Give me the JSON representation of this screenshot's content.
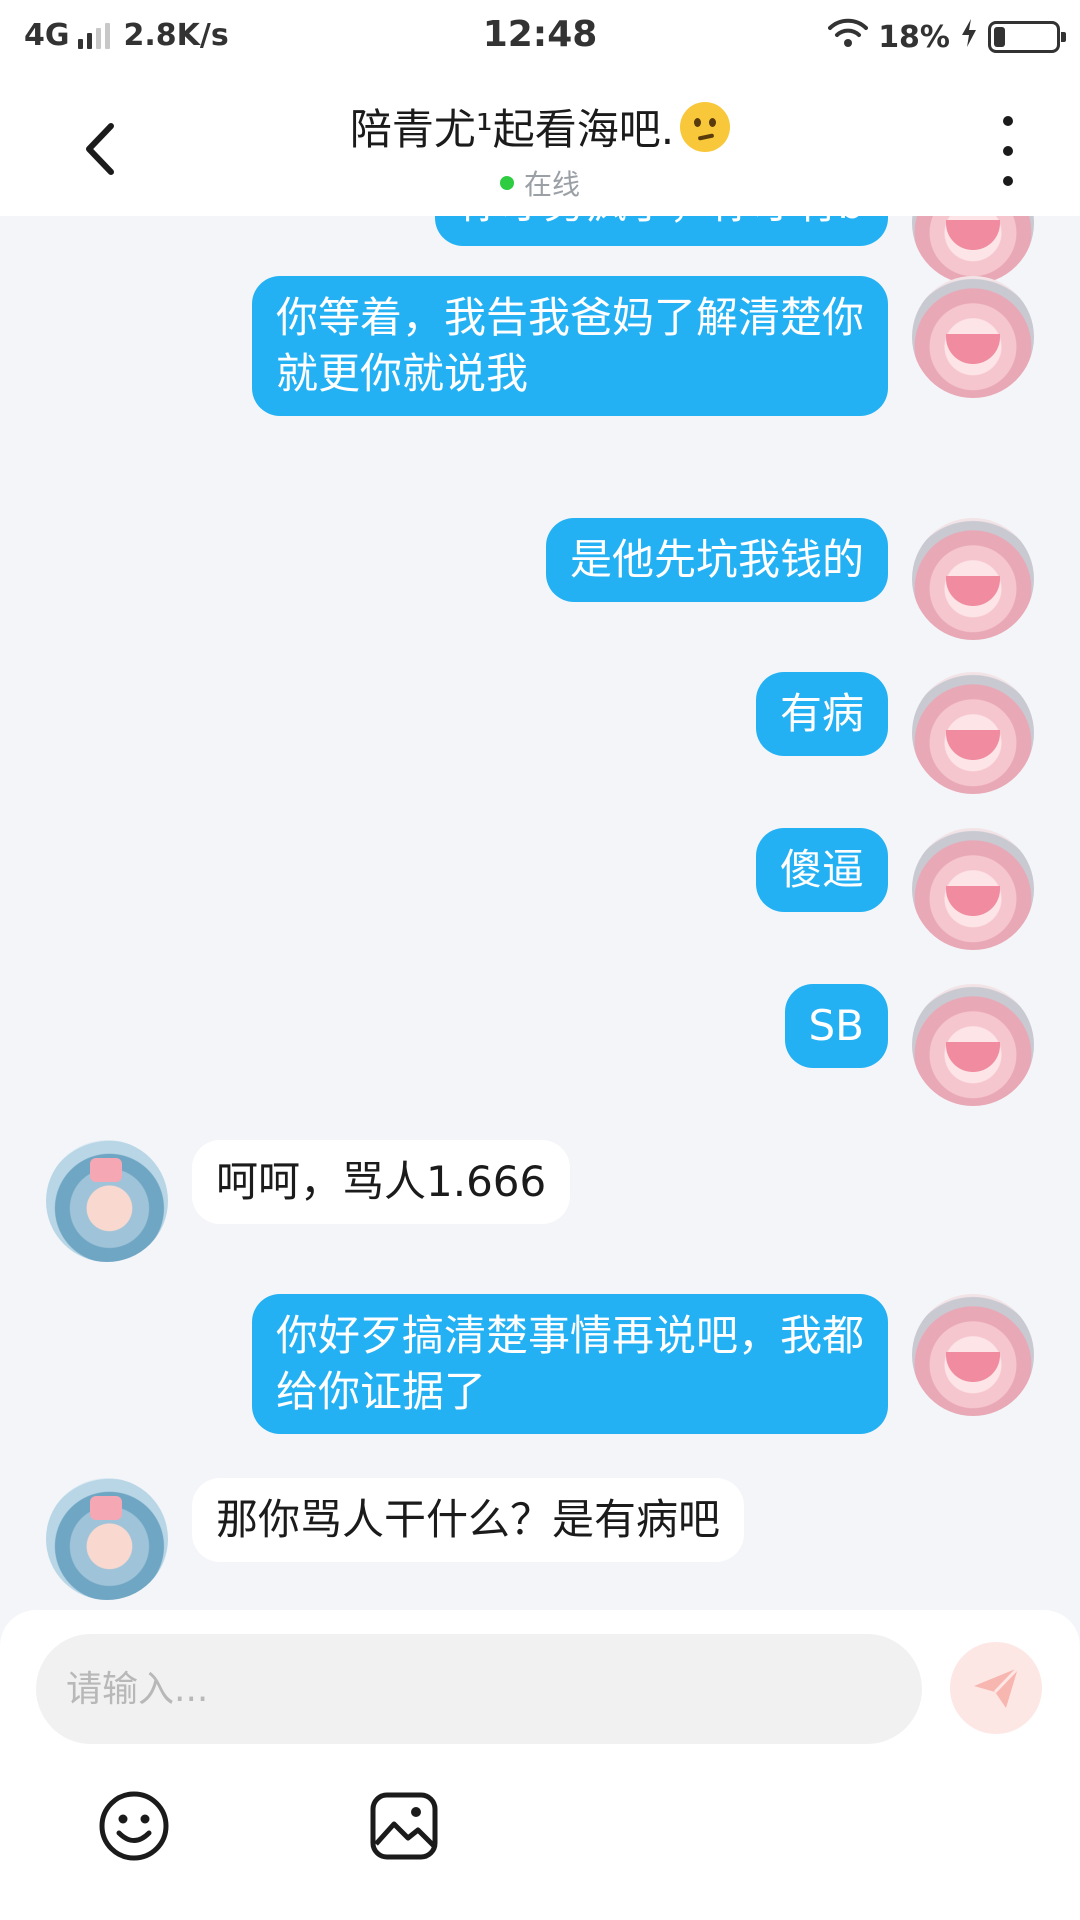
{
  "status_bar": {
    "network": "4G",
    "speed": "2.8K/s",
    "time": "12:48",
    "battery_percent": "18%",
    "battery_level": 0.18,
    "icons": [
      "signal-icon",
      "wifi-icon",
      "charging-icon",
      "battery-icon"
    ]
  },
  "header": {
    "title": "陪青尤¹起看海吧.",
    "title_emoji": "confused-face-emoji",
    "online_text": "在线"
  },
  "messages": [
    {
      "from": "me",
      "text": "你才务疯了，你才有b",
      "partially_visible": true
    },
    {
      "from": "me",
      "text": "你等着，我告我爸妈了解清楚你\n就更你就说我"
    },
    {
      "from": "me",
      "text": "是他先坑我钱的"
    },
    {
      "from": "me",
      "text": "有病"
    },
    {
      "from": "me",
      "text": "傻逼"
    },
    {
      "from": "me",
      "text": "SB"
    },
    {
      "from": "other",
      "text": "呵呵，骂人1.666"
    },
    {
      "from": "me",
      "text": "你好歹搞清楚事情再说吧，我都\n给你证据了"
    },
    {
      "from": "other",
      "text": "那你骂人干什么？是有病吧"
    }
  ],
  "input": {
    "placeholder": "请输入..."
  },
  "colors": {
    "my_bubble": "#24b1f4",
    "other_bubble": "#ffffff",
    "background": "#f3f5f8",
    "online_dot": "#2ecc40",
    "send_button": "#fde7e5",
    "send_icon": "#f7b7b0"
  }
}
